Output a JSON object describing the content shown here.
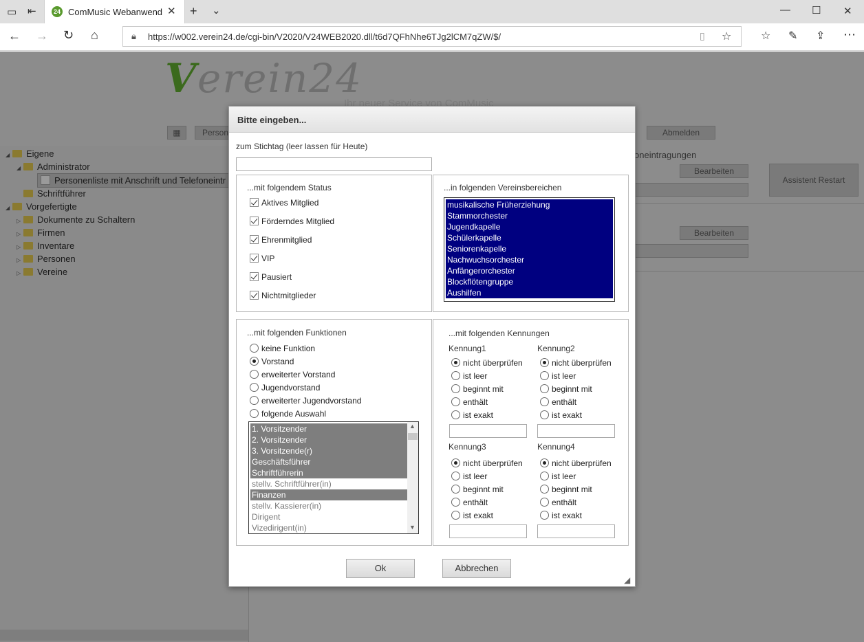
{
  "browser": {
    "tab_title": "ComMusic Webanwend",
    "tab_favicon": "24",
    "url": "https://w002.verein24.de/cgi-bin/V2020/V24WEB2020.dll/t6d7QFhNhe6TJg2lCM7qZW/$/"
  },
  "background_page": {
    "logo": "Verein24",
    "slogan": "Ihr neuer Service von ComMusic",
    "top_buttons": [
      "Person",
      "Abmelden"
    ],
    "section_label": "oneintragungen",
    "edit_buttons": [
      "Bearbeiten",
      "Bearbeiten"
    ],
    "assistant_button": "Assistent Restart",
    "tree": [
      {
        "label": "Eigene",
        "level": 0,
        "expanded": true
      },
      {
        "label": "Administrator",
        "level": 1,
        "expanded": true
      },
      {
        "label": "Personenliste mit Anschrift und Telefoneintr",
        "level": 2,
        "selected": true
      },
      {
        "label": "Schriftführer",
        "level": 1
      },
      {
        "label": "Vorgefertigte",
        "level": 0,
        "expanded": true
      },
      {
        "label": "Dokumente zu Schaltern",
        "level": 1
      },
      {
        "label": "Firmen",
        "level": 1
      },
      {
        "label": "Inventare",
        "level": 1
      },
      {
        "label": "Personen",
        "level": 1
      },
      {
        "label": "Vereine",
        "level": 1
      }
    ]
  },
  "dialog": {
    "title": "Bitte eingeben...",
    "stichtag_label": "zum Stichtag (leer lassen für Heute)",
    "stichtag_value": "",
    "status": {
      "legend": "...mit folgendem Status",
      "items": [
        {
          "label": "Aktives Mitglied",
          "checked": true
        },
        {
          "label": "Förderndes Mitglied",
          "checked": true
        },
        {
          "label": "Ehrenmitglied",
          "checked": true
        },
        {
          "label": "VIP",
          "checked": true
        },
        {
          "label": "Pausiert",
          "checked": true
        },
        {
          "label": "Nichtmitglieder",
          "checked": true
        }
      ]
    },
    "bereiche": {
      "legend": "...in folgenden Vereinsbereichen",
      "items": [
        "musikalische Früherziehung",
        "Stammorchester",
        "Jugendkapelle",
        "Schülerkapelle",
        "Seniorenkapelle",
        "Nachwuchsorchester",
        "Anfängerorchester",
        "Blockflötengruppe",
        "Aushilfen"
      ]
    },
    "funktionen": {
      "legend": "...mit folgenden Funktionen",
      "options": [
        {
          "label": "keine Funktion",
          "selected": false
        },
        {
          "label": "Vorstand",
          "selected": true
        },
        {
          "label": "erweiterter Vorstand",
          "selected": false
        },
        {
          "label": "Jugendvorstand",
          "selected": false
        },
        {
          "label": "erweiterter Jugendvorstand",
          "selected": false
        },
        {
          "label": "folgende Auswahl",
          "selected": false
        }
      ],
      "list": [
        {
          "label": "1. Vorsitzender",
          "selected": true
        },
        {
          "label": "2. Vorsitzender",
          "selected": true
        },
        {
          "label": "3. Vorsitzende(r)",
          "selected": true
        },
        {
          "label": "Geschäftsführer",
          "selected": true
        },
        {
          "label": "Schriftführerin",
          "selected": true
        },
        {
          "label": "stellv. Schriftführer(in)",
          "selected": false
        },
        {
          "label": "Finanzen",
          "selected": true
        },
        {
          "label": "stellv. Kassierer(in)",
          "selected": false
        },
        {
          "label": "Dirigent",
          "selected": false
        },
        {
          "label": "Vizedirigent(in)",
          "selected": false
        }
      ]
    },
    "kennungen": {
      "legend": "...mit folgenden Kennungen",
      "option_labels": [
        "nicht überprüfen",
        "ist leer",
        "beginnt mit",
        "enthält",
        "ist exakt"
      ],
      "groups": [
        {
          "label": "Kennung1",
          "selected": 0,
          "value": ""
        },
        {
          "label": "Kennung2",
          "selected": 0,
          "value": ""
        },
        {
          "label": "Kennung3",
          "selected": 0,
          "value": ""
        },
        {
          "label": "Kennung4",
          "selected": 0,
          "value": ""
        }
      ]
    },
    "ok_label": "Ok",
    "cancel_label": "Abbrechen"
  },
  "colors": {
    "list_selected_blue": "#000080",
    "list_selected_grey": "#7e7e7e",
    "overlay": "#8c8c8c"
  }
}
